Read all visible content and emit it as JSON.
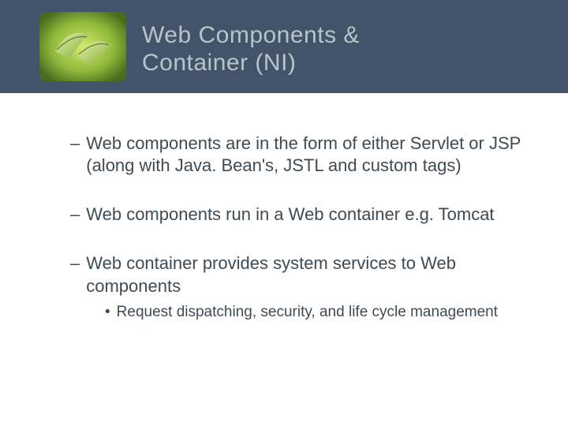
{
  "header": {
    "title_line1": "Web Components &",
    "title_line2": "Container (NI)"
  },
  "bullets": {
    "b1": "Web components are in the form of either Servlet or JSP (along with Java. Bean's, JSTL and custom tags)",
    "b2": "Web components run in a Web container e.g. Tomcat",
    "b3": "Web container provides system services to Web components",
    "b3_sub": "Request dispatching, security, and life cycle management"
  }
}
